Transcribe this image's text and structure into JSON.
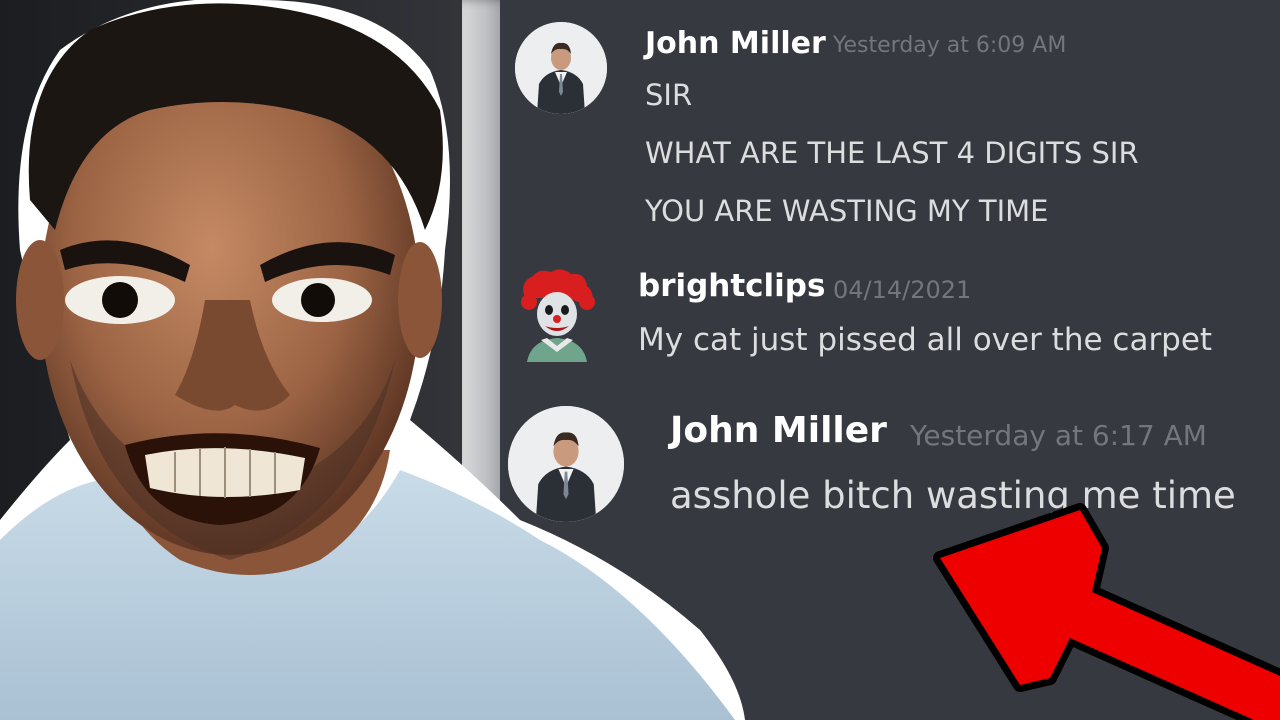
{
  "messages": [
    {
      "username": "John Miller",
      "timestamp": "Yesterday at 6:09 AM",
      "lines": [
        "SIR",
        "WHAT ARE THE LAST 4 DIGITS SIR",
        "YOU ARE WASTING MY TIME"
      ],
      "avatar": "businessman-avatar"
    },
    {
      "username": "brightclips",
      "timestamp": "04/14/2021",
      "lines": [
        "My cat just pissed all over the carpet"
      ],
      "avatar": "clown-avatar"
    },
    {
      "username": "John Miller",
      "timestamp": "Yesterday at 6:17 AM",
      "lines": [
        "asshole bitch wasting me time"
      ],
      "avatar": "businessman-avatar"
    }
  ],
  "colors": {
    "chat_background": "#36393f",
    "username": "#ffffff",
    "timestamp": "#72767d",
    "message_text": "#dcddde",
    "arrow": "#ee0000",
    "arrow_outline": "#000000"
  },
  "icons": [
    "businessman-avatar",
    "clown-avatar",
    "red-arrow"
  ]
}
